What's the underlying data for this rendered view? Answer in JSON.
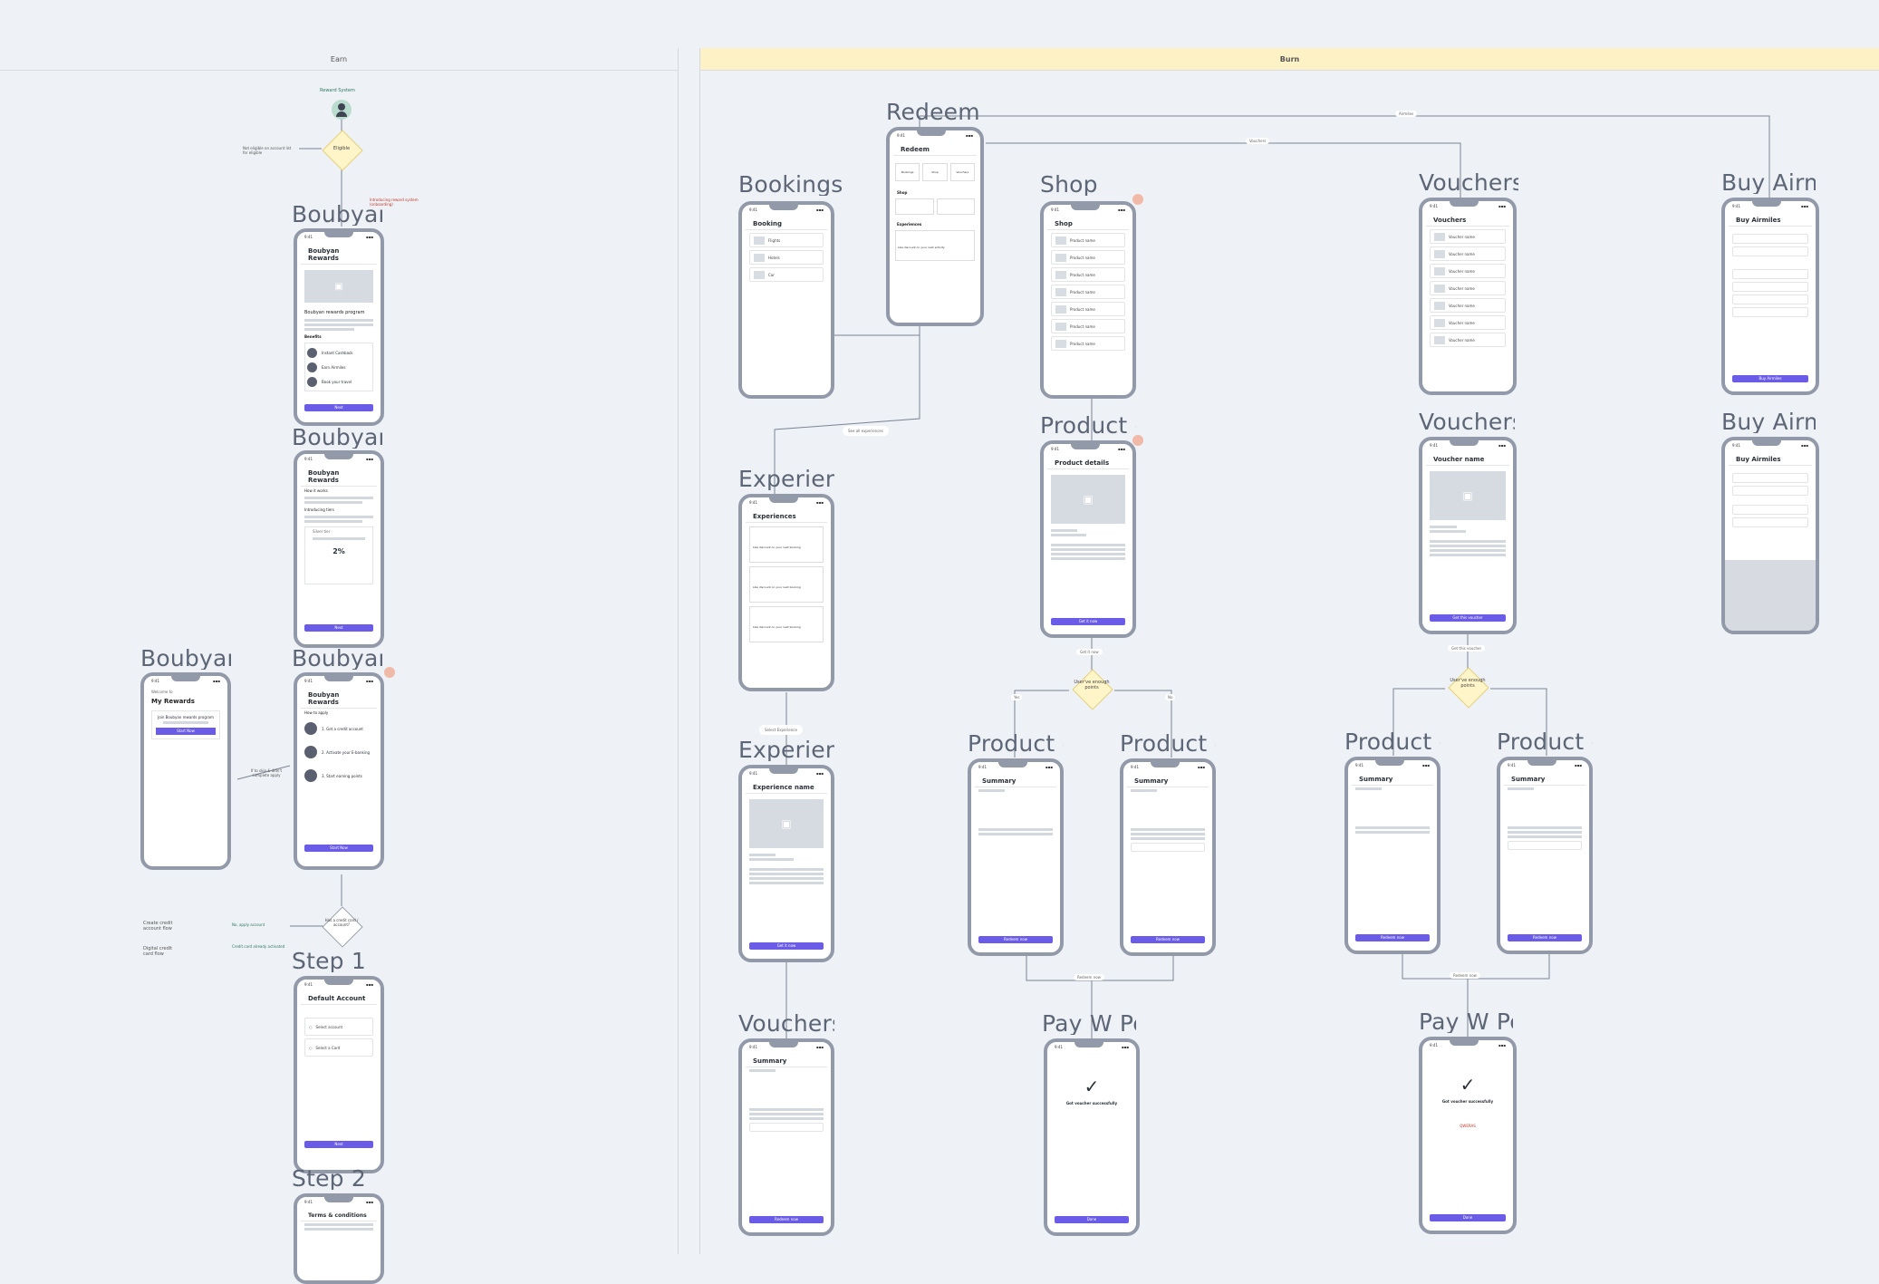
{
  "lanes": {
    "earn": "Earn",
    "burn": "Burn"
  },
  "colors": {
    "canvas": "#eef1f5",
    "burn_header": "#fdf1c6",
    "accent": "#6b5ce7",
    "frame": "#929aaa",
    "decision": "#fff5c8"
  },
  "earn": {
    "actor": "Reward System",
    "decision": "Eligible",
    "decision_left_note": "Not eligible on account list for eligible",
    "decision_down_note": "Introducing reward system (onboarding)",
    "frames": [
      {
        "title": "Boubyan",
        "header": "Boubyan Rewards",
        "subheading": "Boubyan rewards program",
        "section": "Benefits",
        "items": [
          "Instant Cashback",
          "Earn Airmiles",
          "Book your travel"
        ],
        "button": "Next"
      },
      {
        "title": "Boubyan",
        "header": "Boubyan Rewards",
        "subheading": "How it works",
        "section": "Introducing tiers",
        "tier": "Silver tier",
        "stat": "2%",
        "button": "Next"
      },
      {
        "title": "Boubyan",
        "header": "Boubyan Rewards",
        "subheading": "How to apply",
        "items": [
          "1. Get a credit account",
          "2. Activate your E-banking",
          "3. Start earning points"
        ],
        "button": "Start Now"
      },
      {
        "title": "Boubyan",
        "welcome": "Welcome to",
        "header": "My Rewards",
        "card_text": "Join Boubyan rewards program",
        "button": "Start Now"
      }
    ],
    "side_note": "If to skip & didn't complete apply",
    "decision2": "Has a credit card / account?",
    "decision2_notes": [
      "No, apply account",
      "Credit card already activated"
    ],
    "flows": [
      "Create credit account flow",
      "Digital credit card flow"
    ],
    "step1": {
      "title": "Step 1",
      "header": "Default Account",
      "options": [
        "Select account",
        "Select a Card"
      ],
      "button": "Next"
    },
    "step2": {
      "title": "Step 2",
      "header": "Terms & conditions"
    }
  },
  "burn": {
    "redeem": {
      "title": "Redeem",
      "header": "Redeem",
      "tabs": [
        "Bookings",
        "Shop",
        "Vouchers"
      ],
      "shop": "Shop",
      "experiences": "Experiences",
      "exp_item": "Like discount on your next activity"
    },
    "bookings": {
      "title": "Bookings",
      "header": "Booking",
      "rows": [
        "Flights",
        "Hotels",
        "Car"
      ]
    },
    "shop": {
      "title": "Shop",
      "header": "Shop",
      "rows": [
        "Product name",
        "Product name",
        "Product name",
        "Product name",
        "Product name",
        "Product name",
        "Product name"
      ]
    },
    "vouchers": {
      "title": "Vouchers",
      "header": "Vouchers",
      "rows": [
        "Voucher name",
        "Voucher name",
        "Voucher name",
        "Voucher name",
        "Voucher name",
        "Voucher name",
        "Voucher name"
      ]
    },
    "buy_airmiles": {
      "title": "Buy Airmiles",
      "header": "Buy Airmiles",
      "button": "Buy Airmiles"
    },
    "product_details": {
      "title": "Product details",
      "header": "Product details",
      "button": "Get it now"
    },
    "voucher_details": {
      "title": "Vouchers",
      "header": "Voucher name",
      "button": "Get this voucher"
    },
    "buy_airmiles_2": {
      "title": "Buy Airmiles",
      "header": "Buy Airmiles"
    },
    "experiences": {
      "title": "Experiences",
      "header": "Experiences",
      "items": [
        "Like discount on your next booking",
        "Like discount on your next booking",
        "Like discount on your next booking"
      ]
    },
    "experience_name": {
      "title": "Experiences",
      "header": "Experience name",
      "button": "Get it now"
    },
    "decision": "User've enough points",
    "summaries": [
      {
        "title": "Product details",
        "header": "Summary",
        "button": "Redeem now"
      },
      {
        "title": "Product details",
        "header": "Summary",
        "button": "Redeem now"
      },
      {
        "title": "Product details",
        "header": "Summary",
        "button": "Redeem now"
      },
      {
        "title": "Product details",
        "header": "Summary",
        "button": "Redeem now"
      }
    ],
    "vouchers_summary": {
      "title": "Vouchers",
      "header": "Summary",
      "button": "Redeem now"
    },
    "pay": [
      {
        "title": "Pay W Points",
        "message": "Got voucher successfully",
        "button": "Done"
      },
      {
        "title": "Pay W Points",
        "message": "Got voucher successfully",
        "code": "QWERAS",
        "button": "Done"
      }
    ],
    "labels": {
      "airmiles": "Airmiles",
      "vouchers": "Vouchers",
      "see_all": "See all experiences",
      "select_exp": "Select Experience",
      "get_it_now": "Get it now",
      "redeem_now": "Redeem now",
      "get_voucher": "Get this voucher",
      "yes": "Yes",
      "no": "No"
    }
  }
}
